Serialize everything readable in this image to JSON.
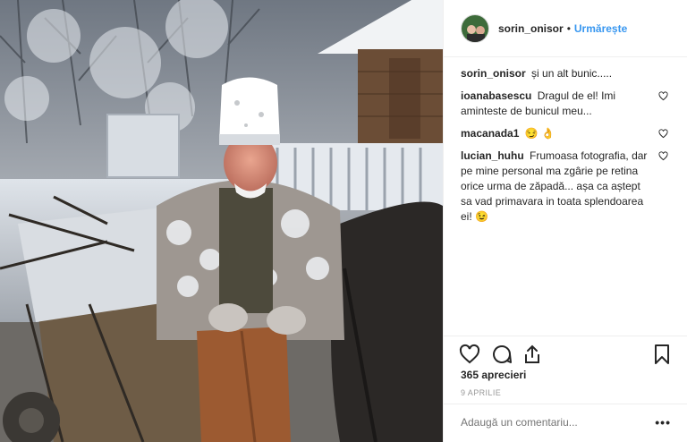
{
  "header": {
    "username": "sorin_onisor",
    "separator": "•",
    "follow_label": "Urmărește"
  },
  "comments": [
    {
      "user": "sorin_onisor",
      "text": "și un alt bunic.....",
      "has_like": false
    },
    {
      "user": "ioanabasescu",
      "text": "Dragul de el! Imi aminteste de bunicul meu...",
      "has_like": true
    },
    {
      "user": "macanada1",
      "text": "😏 👌",
      "has_like": true
    },
    {
      "user": "lucian_huhu",
      "text": "Frumoasa fotografia, dar pe mine personal ma zgârie pe retina orice urma de zăpadă... așa ca aștept sa vad primavara in toata splendoarea ei! 😉",
      "has_like": true
    }
  ],
  "actions": {
    "like_icon": "heart-icon",
    "comment_icon": "comment-icon",
    "share_icon": "share-icon",
    "save_icon": "bookmark-icon"
  },
  "likes_text": "365 aprecieri",
  "date_text": "9 APRILIE",
  "add_comment": {
    "placeholder": "Adaugă un comentariu..."
  },
  "more_label": "•••",
  "colors": {
    "accent": "#3897f0",
    "text": "#262626",
    "muted": "#999999",
    "divider": "#efefef"
  }
}
